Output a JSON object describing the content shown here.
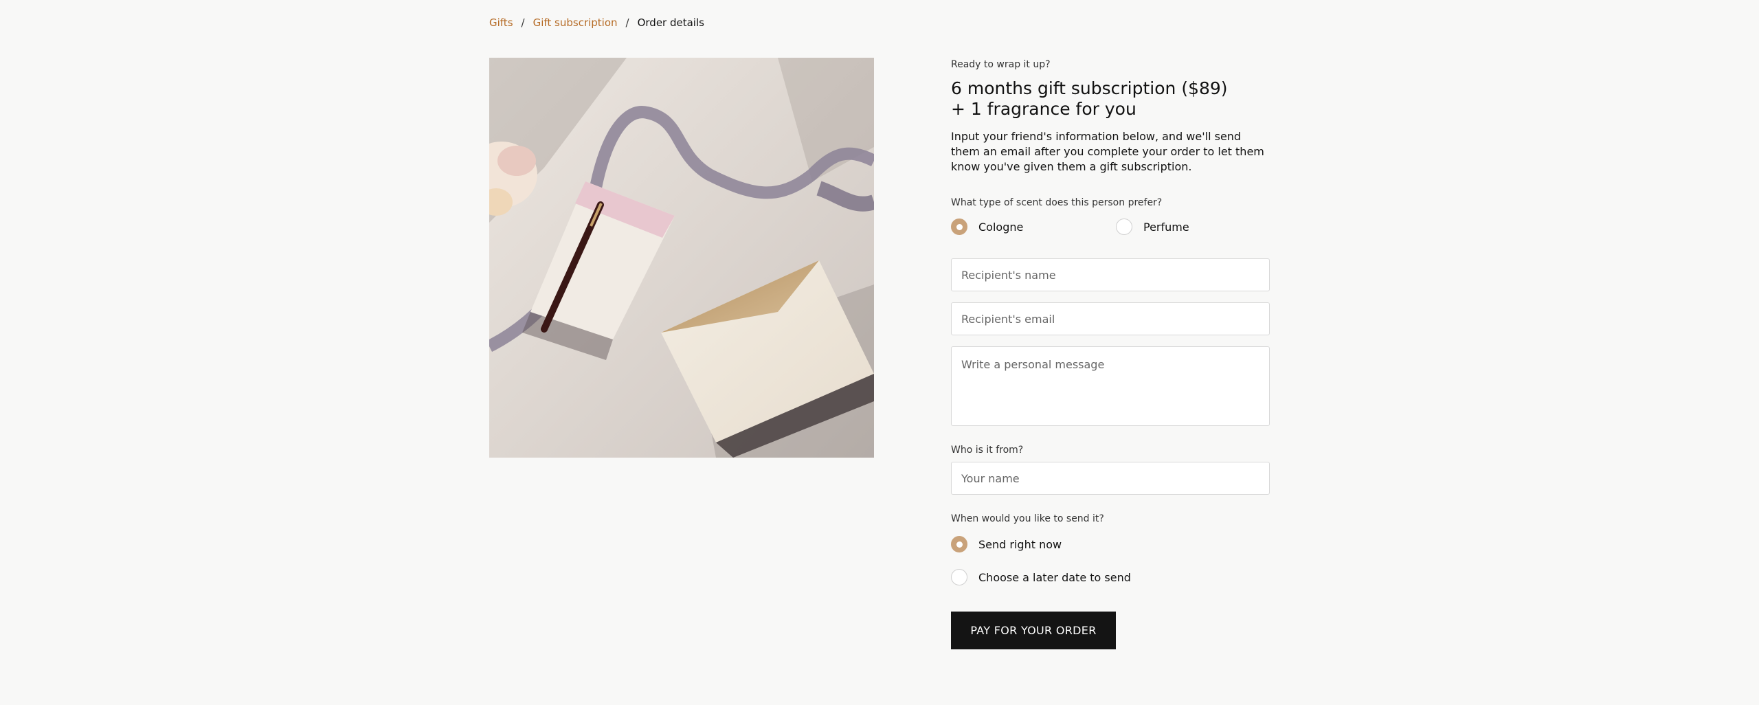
{
  "breadcrumb": {
    "items": [
      {
        "label": "Gifts"
      },
      {
        "label": "Gift subscription"
      },
      {
        "label": "Order details"
      }
    ],
    "separator": "/"
  },
  "hero_image": {
    "alt": "Gift envelope with ribbon, pen and note card"
  },
  "form": {
    "eyebrow": "Ready to wrap it up?",
    "title_line1": "6 months gift subscription ($89)",
    "title_line2": "+ 1 fragrance for you",
    "intro": "Input your friend's information below, and we'll send them an email after you complete your order to let them know you've given them a gift subscription.",
    "scent_question": "What type of scent does this person prefer?",
    "scent_options": [
      {
        "label": "Cologne",
        "selected": true
      },
      {
        "label": "Perfume",
        "selected": false
      }
    ],
    "recipient_name_placeholder": "Recipient's name",
    "recipient_email_placeholder": "Recipient's email",
    "message_placeholder": "Write a personal message",
    "from_question": "Who is it from?",
    "your_name_placeholder": "Your name",
    "send_question": "When would you like to send it?",
    "send_options": [
      {
        "label": "Send right now",
        "selected": true
      },
      {
        "label": "Choose a later date to send",
        "selected": false
      }
    ],
    "pay_label": "PAY FOR YOUR ORDER"
  },
  "colors": {
    "accent": "#b56a24",
    "radio_selected": "#c9a27a",
    "button": "#141414",
    "background": "#f8f8f7"
  }
}
